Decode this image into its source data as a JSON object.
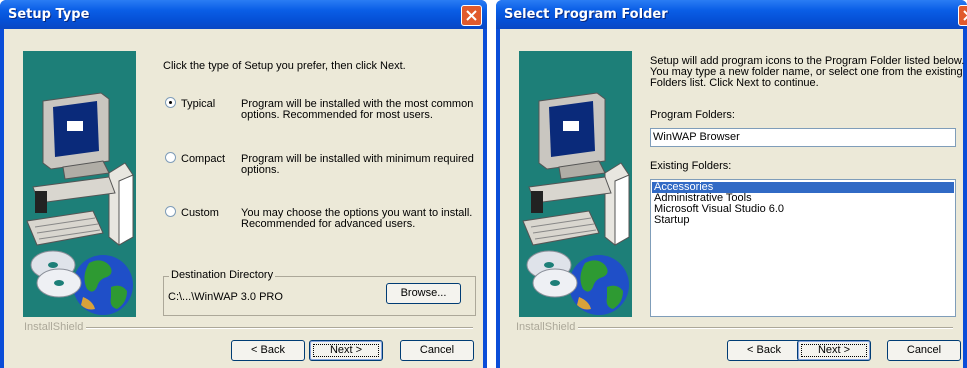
{
  "setup_type": {
    "title": "Setup Type",
    "instruction": "Click the type of Setup you prefer, then click Next.",
    "options": [
      {
        "label": "Typical",
        "desc1": "Program will be installed with the most common",
        "desc2": "options. Recommended for most users.",
        "selected": true
      },
      {
        "label": "Compact",
        "desc1": "Program will be installed with minimum required",
        "desc2": "options.",
        "selected": false
      },
      {
        "label": "Custom",
        "desc1": "You may choose the options you want to install.",
        "desc2": "Recommended for advanced users.",
        "selected": false
      }
    ],
    "destination_label": "Destination Directory",
    "destination_path": "C:\\...\\WinWAP 3.0 PRO",
    "browse_label": "Browse...",
    "installshield": "InstallShield",
    "back_label": "< Back",
    "next_label": "Next >",
    "cancel_label": "Cancel"
  },
  "select_folder": {
    "title": "Select Program Folder",
    "info_line1": "Setup will add program icons to the Program Folder listed below.",
    "info_line2": "You may type a new folder name, or select one from the existing",
    "info_line3": "Folders list.  Click Next to continue.",
    "program_folders_label": "Program Folders:",
    "program_folder_value": "WinWAP Browser",
    "existing_folders_label": "Existing Folders:",
    "existing_folders": [
      "Accessories",
      "Administrative Tools",
      "Microsoft Visual Studio 6.0",
      "Startup"
    ],
    "installshield": "InstallShield",
    "back_label": "< Back",
    "next_label": "Next >",
    "cancel_label": "Cancel"
  },
  "icons": {
    "close": "close-icon",
    "computer": "computer-illustration",
    "globe": "globe-illustration",
    "cd": "cd-illustration"
  },
  "colors": {
    "title_blue": "#0a5ee6",
    "dialog_bg": "#ece9d8",
    "art_teal": "#1d7f78",
    "selection": "#316ac5",
    "close_red": "#e15a2c"
  }
}
